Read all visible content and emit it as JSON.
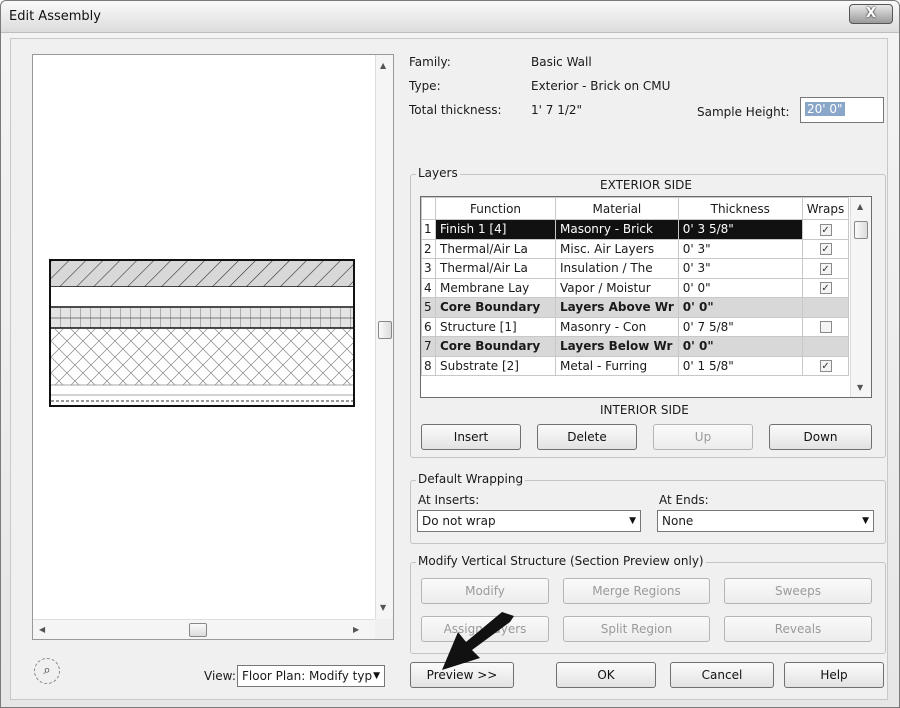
{
  "window": {
    "title": "Edit Assembly",
    "close_glyph": "X"
  },
  "info": {
    "family_label": "Family:",
    "family_value": "Basic Wall",
    "type_label": "Type:",
    "type_value": "Exterior - Brick on CMU",
    "thickness_label": "Total thickness:",
    "thickness_value": "1'  7 1/2\"",
    "sample_height_label": "Sample Height:",
    "sample_height_value": "20'  0\""
  },
  "layers": {
    "group_label": "Layers",
    "exterior_label": "EXTERIOR SIDE",
    "interior_label": "INTERIOR SIDE",
    "columns": [
      "",
      "Function",
      "Material",
      "Thickness",
      "Wraps"
    ],
    "rows": [
      {
        "num": "1",
        "function": "Finish 1 [4]",
        "material": "Masonry - Brick",
        "thickness": "0'  3 5/8\"",
        "wraps": true,
        "selected": true
      },
      {
        "num": "2",
        "function": "Thermal/Air La",
        "material": "Misc. Air Layers",
        "thickness": "0'  3\"",
        "wraps": true
      },
      {
        "num": "3",
        "function": "Thermal/Air La",
        "material": "Insulation / The",
        "thickness": "0'  3\"",
        "wraps": true
      },
      {
        "num": "4",
        "function": "Membrane Lay",
        "material": "Vapor / Moistur",
        "thickness": "0'  0\"",
        "wraps": true
      },
      {
        "num": "5",
        "function": "Core Boundary",
        "material": "Layers Above Wr",
        "thickness": "0'  0\"",
        "core": true
      },
      {
        "num": "6",
        "function": "Structure [1]",
        "material": "Masonry - Con",
        "thickness": "0'  7 5/8\"",
        "wraps": false
      },
      {
        "num": "7",
        "function": "Core Boundary",
        "material": "Layers Below Wr",
        "thickness": "0'  0\"",
        "core": true
      },
      {
        "num": "8",
        "function": "Substrate [2]",
        "material": "Metal - Furring",
        "thickness": "0'  1 5/8\"",
        "wraps": true
      }
    ],
    "buttons": {
      "insert": "Insert",
      "delete": "Delete",
      "up": "Up",
      "down": "Down"
    }
  },
  "wrapping": {
    "group_label": "Default Wrapping",
    "inserts_label": "At Inserts:",
    "inserts_value": "Do not wrap",
    "ends_label": "At Ends:",
    "ends_value": "None"
  },
  "modify": {
    "group_label": "Modify Vertical Structure (Section Preview only)",
    "modify": "Modify",
    "merge": "Merge Regions",
    "sweeps": "Sweeps",
    "assign": "Assign Layers",
    "split": "Split Region",
    "reveals": "Reveals"
  },
  "footer": {
    "preview": "Preview >>",
    "ok": "OK",
    "cancel": "Cancel",
    "help": "Help",
    "view_label": "View:",
    "view_value": "Floor Plan: Modify typ"
  }
}
